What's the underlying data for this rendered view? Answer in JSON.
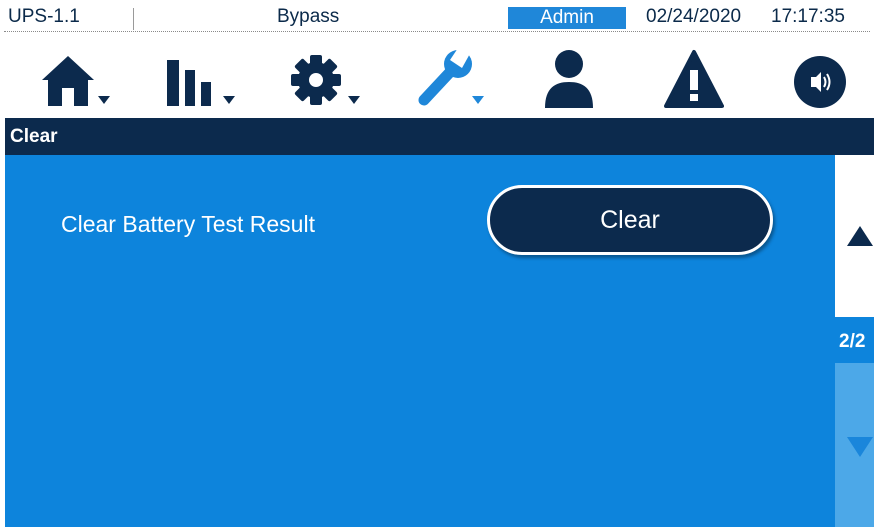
{
  "status_bar": {
    "device": "UPS-1.1",
    "mode": "Bypass",
    "user": "Admin",
    "date": "02/24/2020",
    "time": "17:17:35"
  },
  "toolbar": {
    "icons": [
      "home-icon",
      "bar-chart-icon",
      "gear-icon",
      "wrench-icon",
      "user-icon",
      "warning-icon",
      "speaker-icon"
    ],
    "active": "wrench-icon"
  },
  "page": {
    "title": "Clear"
  },
  "content": {
    "items": [
      {
        "label": "Clear Battery Test Result",
        "button": "Clear"
      }
    ]
  },
  "pager": {
    "indicator": "2/2"
  },
  "colors": {
    "navy": "#0c2a4d",
    "content_blue": "#0d84dc",
    "active_icon": "#1f87d9",
    "pager_disabled": "#4ca8e8"
  }
}
